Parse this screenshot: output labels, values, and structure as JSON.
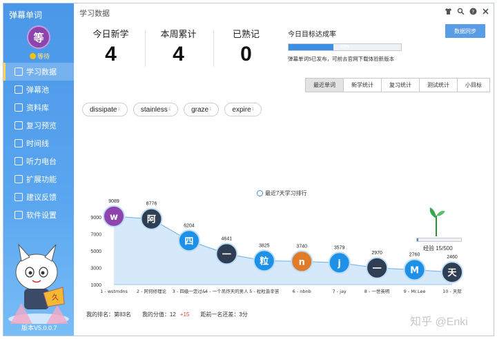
{
  "app": {
    "title": "弹幕单词"
  },
  "user": {
    "avatar_char": "等",
    "level_label": "等待",
    "avatar_color": "#8e44ad"
  },
  "sidebar": {
    "items": [
      {
        "label": "学习数据",
        "icon": "bar-chart-icon",
        "active": true
      },
      {
        "label": "弹幕池",
        "icon": "barrage-icon"
      },
      {
        "label": "资料库",
        "icon": "library-icon"
      },
      {
        "label": "复习预览",
        "icon": "calendar-icon"
      },
      {
        "label": "时间线",
        "icon": "hourglass-icon"
      },
      {
        "label": "听力电台",
        "icon": "headphone-icon"
      },
      {
        "label": "扩展功能",
        "icon": "grid-icon"
      },
      {
        "label": "建议反馈",
        "icon": "lightbulb-icon"
      },
      {
        "label": "软件设置",
        "icon": "gear-icon"
      }
    ],
    "version": "版本V5.0.0.7"
  },
  "header": {
    "title": "学习数据"
  },
  "stats": {
    "today_new_label": "今日新学",
    "today_new_value": "4",
    "week_total_label": "本周累计",
    "week_total_value": "4",
    "mastered_label": "已熟记",
    "mastered_value": "0"
  },
  "goal": {
    "title": "今日目标达成率",
    "percent_label": "40%",
    "progress": 0.4,
    "notice": "弹幕单词5已发布，可前去官网下载体验新版本"
  },
  "sync_button": "数据同步",
  "tabs": [
    "最近单词",
    "新学统计",
    "复习统计",
    "测试统计",
    "小目标"
  ],
  "recent_words": [
    {
      "word": "dissipate",
      "count": "1"
    },
    {
      "word": "stainless",
      "count": "1"
    },
    {
      "word": "graze",
      "count": "1"
    },
    {
      "word": "expire",
      "count": "1"
    }
  ],
  "chart_data": {
    "type": "area",
    "legend": "最近7天学习排行",
    "y_ticks": [
      "9000",
      "7000",
      "5000",
      "3000",
      "1000"
    ],
    "ylim": [
      1000,
      9000
    ],
    "points": [
      {
        "rank_label": "1 - wstmdns",
        "avatar": "w",
        "value": 9089,
        "color": "#8e44ad"
      },
      {
        "rank_label": "2 - 阿何修理论",
        "avatar": "阿",
        "value": 8776,
        "color": "#2f3e52"
      },
      {
        "rank_label": "3 - 四级一定过&",
        "avatar": "四",
        "value": 6204,
        "color": "#1e90e8"
      },
      {
        "rank_label": "4 - 一个吊炸天的男人",
        "avatar": "一",
        "value": 4641,
        "color": "#2f3e52"
      },
      {
        "rank_label": "5 - 粒粒皆辛苦",
        "avatar": "粒",
        "value": 3825,
        "color": "#1e90e8"
      },
      {
        "rank_label": "6 - nbnb",
        "avatar": "n",
        "value": 3740,
        "color": "#e07b2a"
      },
      {
        "rank_label": "7 - jay",
        "avatar": "j",
        "value": 3579,
        "color": "#1e90e8"
      },
      {
        "rank_label": "8 - 一世英明",
        "avatar": "一",
        "value": 2970,
        "color": "#2f3e52"
      },
      {
        "rank_label": "9 - Mr.Lee",
        "avatar": "M",
        "value": 2760,
        "color": "#1e90e8"
      },
      {
        "rank_label": "10 - 天际",
        "avatar": "天",
        "value": 2460,
        "color": "#2f3e52"
      }
    ],
    "grid": false
  },
  "experience": {
    "label": "经验 15/500",
    "progress": 0.03
  },
  "footer": {
    "rank": "我的排名：第83名",
    "score": "我的分值：12",
    "score_plus": "+15",
    "gap": "距前一名还差：3分"
  },
  "watermark": "知乎 @Enki"
}
